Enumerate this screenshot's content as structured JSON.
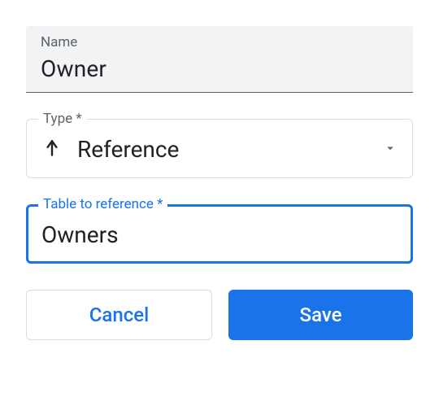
{
  "name_field": {
    "label": "Name",
    "value": "Owner"
  },
  "type_field": {
    "label": "Type *",
    "value": "Reference",
    "icon": "merge-up"
  },
  "reference_field": {
    "label": "Table to reference *",
    "value": "Owners"
  },
  "buttons": {
    "cancel": "Cancel",
    "save": "Save"
  }
}
